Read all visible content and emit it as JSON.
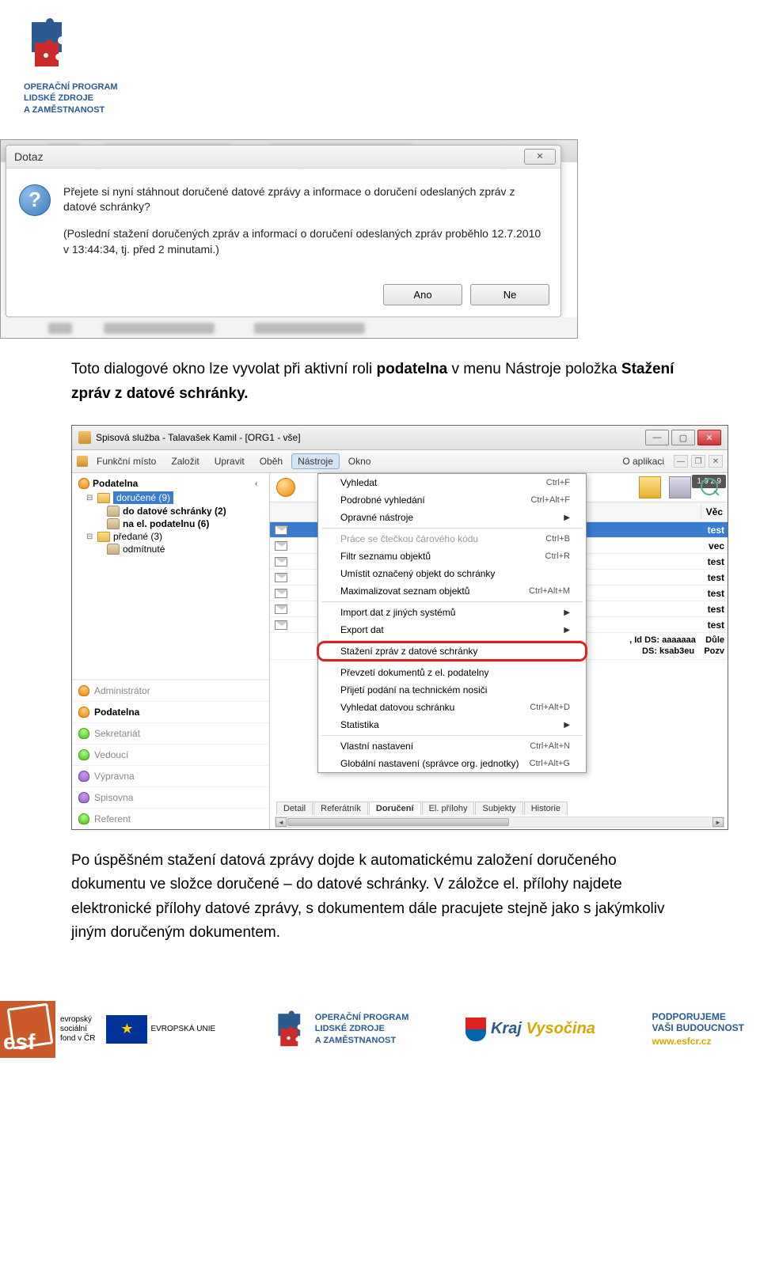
{
  "header": {
    "line1": "OPERAČNÍ PROGRAM",
    "line2": "LIDSKÉ ZDROJE",
    "line3": "A ZAMĚSTNANOST"
  },
  "dialog": {
    "title": "Dotaz",
    "icon_glyph": "?",
    "para1": "Přejete si nyní stáhnout doručené datové zprávy a informace o doručení odeslaných zpráv z datové schránky?",
    "para2": "(Poslední stažení doručených zpráv a informací o doručení odeslaných zpráv proběhlo 12.7.2010 v 13:44:34, tj. před 2 minutami.)",
    "btn_yes": "Ano",
    "btn_no": "Ne",
    "close_glyph": "✕"
  },
  "para1_text": "Toto dialogové okno lze vyvolat při aktivní roli ",
  "para1_bold1": "podatelna",
  "para1_mid": " v menu Nástroje položka ",
  "para1_bold2": "Stažení zpráv z datové schránky.",
  "app": {
    "title": "Spisová služba - Talavašek Kamil - [ORG1 - vše]",
    "menus": [
      "Funkční místo",
      "Založit",
      "Upravit",
      "Oběh",
      "Nástroje",
      "Okno"
    ],
    "menu_right": "O aplikaci",
    "count_badge": "1-9 z 9",
    "table_header": "Věc",
    "tree": {
      "root": "Podatelna",
      "n1": "doručené (9)",
      "n1a": "do datové schránky (2)",
      "n1b": "na el. podatelnu (6)",
      "n2": "předané (3)",
      "n2a": "odmítnuté"
    },
    "roles": [
      "Administrátor",
      "Podatelna",
      "Sekretariát",
      "Vedoucí",
      "Výpravna",
      "Spisovna",
      "Referent"
    ],
    "rows": [
      "test",
      "vec",
      "test",
      "test",
      "test",
      "test",
      "test"
    ],
    "multi1": ", Id DS: aaaaaaa",
    "multi2": "DS: ksab3eu",
    "row8": "Důle",
    "row9": "Pozv",
    "tabs": [
      "Detail",
      "Referátník",
      "Doručení",
      "El. přílohy",
      "Subjekty",
      "Historie"
    ]
  },
  "dropdown": {
    "items": [
      {
        "label": "Vyhledat",
        "shortcut": "Ctrl+F"
      },
      {
        "label": "Podrobné vyhledání",
        "shortcut": "Ctrl+Alt+F"
      },
      {
        "label": "Opravné nástroje",
        "arrow": true,
        "sep_after": true
      },
      {
        "label": "Práce se čtečkou čárového kódu",
        "shortcut": "Ctrl+B",
        "disabled": true
      },
      {
        "label": "Filtr seznamu objektů",
        "shortcut": "Ctrl+R"
      },
      {
        "label": "Umístit označený objekt do schránky"
      },
      {
        "label": "Maximalizovat seznam objektů",
        "shortcut": "Ctrl+Alt+M",
        "sep_after": true
      },
      {
        "label": "Import dat z jiných systémů",
        "arrow": true
      },
      {
        "label": "Export dat",
        "arrow": true,
        "sep_after": true
      },
      {
        "label": "Stažení zpráv z datové schránky",
        "highlighted": true,
        "sep_after": true
      },
      {
        "label": "Převzetí dokumentů z el. podatelny"
      },
      {
        "label": "Přijetí podání na technickém nosiči"
      },
      {
        "label": "Vyhledat datovou schránku",
        "shortcut": "Ctrl+Alt+D"
      },
      {
        "label": "Statistika",
        "arrow": true,
        "sep_after": true
      },
      {
        "label": "Vlastní nastavení",
        "shortcut": "Ctrl+Alt+N"
      },
      {
        "label": "Globální nastavení (správce org. jednotky)",
        "shortcut": "Ctrl+Alt+G"
      }
    ]
  },
  "para2_text": "Po úspěšném stažení datová zprávy dojde k automatickému založení doručeného dokumentu ve složce doručené – do datové schránky. V záložce el. přílohy najdete elektronické přílohy datové zprávy, s dokumentem dále pracujete stejně jako s jakýmkoliv jiným doručeným dokumentem.",
  "footer": {
    "esf_label": "esf",
    "esf_line1": "evropský",
    "esf_line2": "sociální",
    "esf_line3": "fond v ČR",
    "eu_label": "EVROPSKÁ UNIE",
    "op_line1": "OPERAČNÍ PROGRAM",
    "op_line2": "LIDSKÉ ZDROJE",
    "op_line3": "A ZAMĚSTNANOST",
    "kraj1": "Kraj",
    "kraj2": "Vysočina",
    "pod_line1": "PODPORUJEME",
    "pod_line2": "VAŠI BUDOUCNOST",
    "pod_url": "www.esfcr.cz"
  }
}
